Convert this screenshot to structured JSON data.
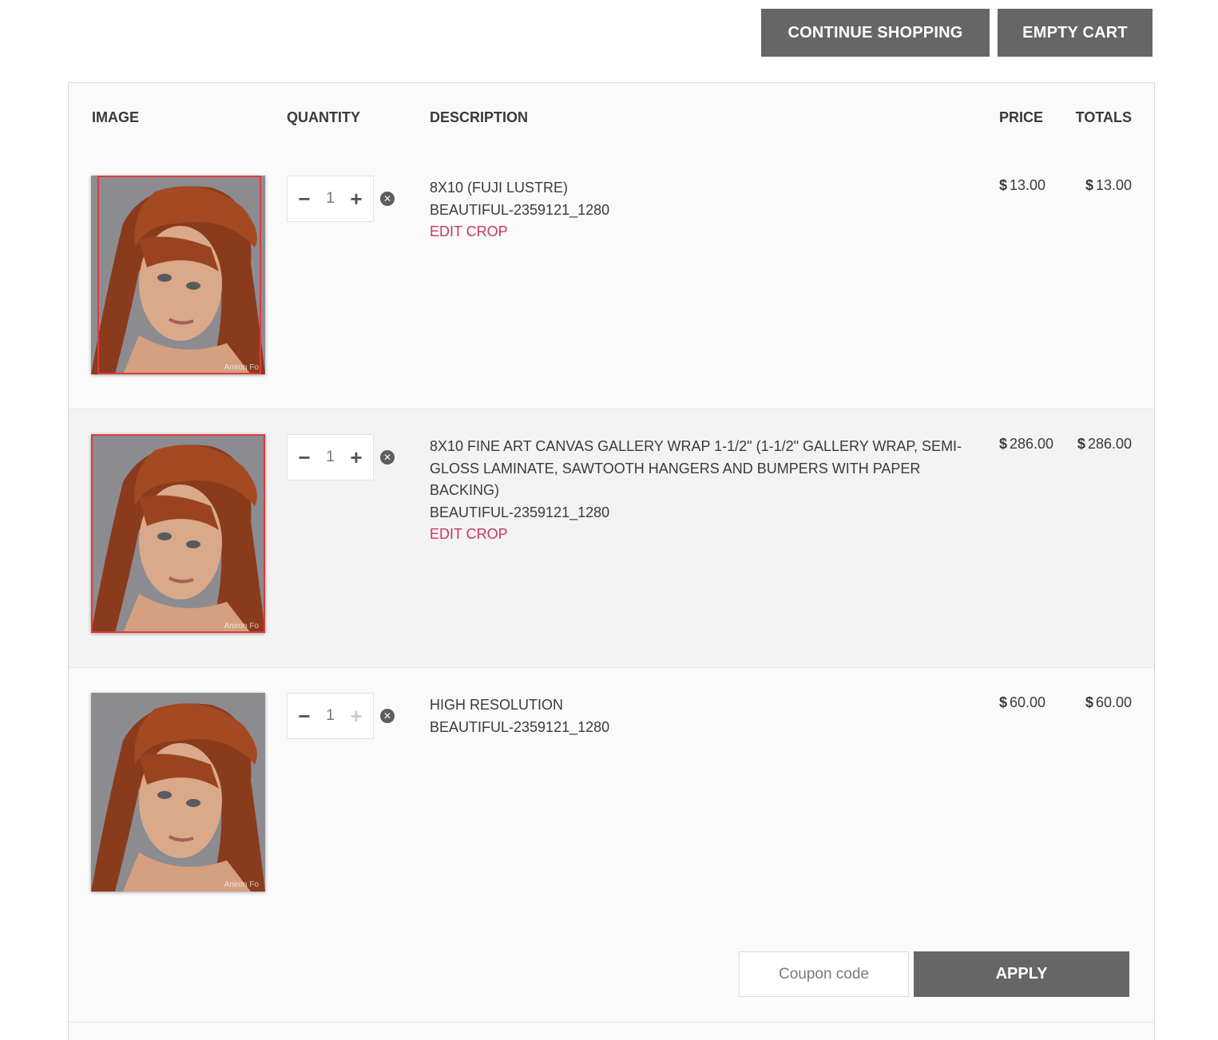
{
  "toolbar": {
    "continue_label": "CONTINUE SHOPPING",
    "empty_label": "EMPTY CART"
  },
  "table": {
    "headers": {
      "image": "IMAGE",
      "quantity": "QUANTITY",
      "description": "DESCRIPTION",
      "price": "PRICE",
      "totals": "TOTALS"
    },
    "currency_symbol": "$",
    "items": [
      {
        "quantity": "1",
        "product": "8X10 (FUJI LUSTRE)",
        "filename": "BEAUTIFUL-2359121_1280",
        "edit_crop": "EDIT CROP",
        "price": "13.00",
        "total": "13.00",
        "watermark": "Aniron Fo"
      },
      {
        "quantity": "1",
        "product": "8X10 FINE ART CANVAS GALLERY WRAP 1-1/2\" (1-1/2\" GALLERY WRAP, SEMI-GLOSS LAMINATE, SAWTOOTH HANGERS AND BUMPERS WITH PAPER BACKING)",
        "filename": "BEAUTIFUL-2359121_1280",
        "edit_crop": "EDIT CROP",
        "price": "286.00",
        "total": "286.00",
        "watermark": "Aniron Fo"
      },
      {
        "quantity": "1",
        "product": "HIGH RESOLUTION",
        "filename": "BEAUTIFUL-2359121_1280",
        "price": "60.00",
        "total": "60.00",
        "watermark": "Aniron Fo"
      }
    ]
  },
  "coupon": {
    "placeholder": "Coupon code",
    "apply_label": "APPLY"
  },
  "icons": {
    "decrease": "minus-icon",
    "increase": "plus-icon",
    "remove": "close-circle-icon"
  },
  "colors": {
    "button_bg": "#666666",
    "edit_crop": "#c7385d",
    "crop_frame": "#e0393e"
  }
}
